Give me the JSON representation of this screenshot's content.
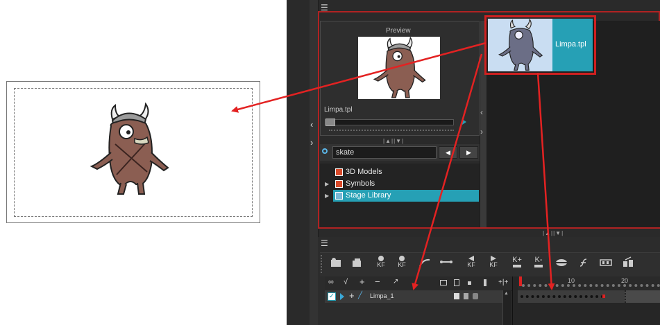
{
  "preview": {
    "title": "Preview",
    "filename": "Limpa.tpl"
  },
  "template_tile": {
    "label": "Limpa.tpl"
  },
  "library": {
    "search_value": "skate",
    "tree": [
      {
        "label": "3D Models",
        "icon": "folder-red-icon",
        "selected": false
      },
      {
        "label": "Symbols",
        "icon": "folder-red-icon",
        "selected": false
      },
      {
        "label": "Stage Library",
        "icon": "folder-blue-icon",
        "selected": true
      }
    ]
  },
  "toolbar": {
    "buttons": [
      {
        "name": "add-drawing-layer",
        "caption": ""
      },
      {
        "name": "add-group-layer",
        "caption": ""
      },
      {
        "name": "add-keyframe",
        "caption": "KF"
      },
      {
        "name": "remove-keyframe",
        "caption": "KF"
      },
      {
        "name": "motion-path",
        "caption": ""
      },
      {
        "name": "constant-segment",
        "caption": ""
      },
      {
        "name": "previous-keyframe",
        "caption": "KF"
      },
      {
        "name": "next-keyframe",
        "caption": "KF"
      },
      {
        "name": "set-ease",
        "caption": "K+"
      },
      {
        "name": "set-stop",
        "caption": "K-"
      },
      {
        "name": "onion-skin",
        "caption": ""
      },
      {
        "name": "function",
        "caption": ""
      },
      {
        "name": "extend-exposure",
        "caption": ""
      },
      {
        "name": "lock",
        "caption": ""
      }
    ]
  },
  "timeline": {
    "layer_name": "Limpa_1",
    "frame_marks": [
      "10",
      "20"
    ]
  },
  "colors": {
    "panel_bg": "#2a2a2a",
    "selection": "#26a0b5",
    "annotation_red": "#e32222"
  }
}
